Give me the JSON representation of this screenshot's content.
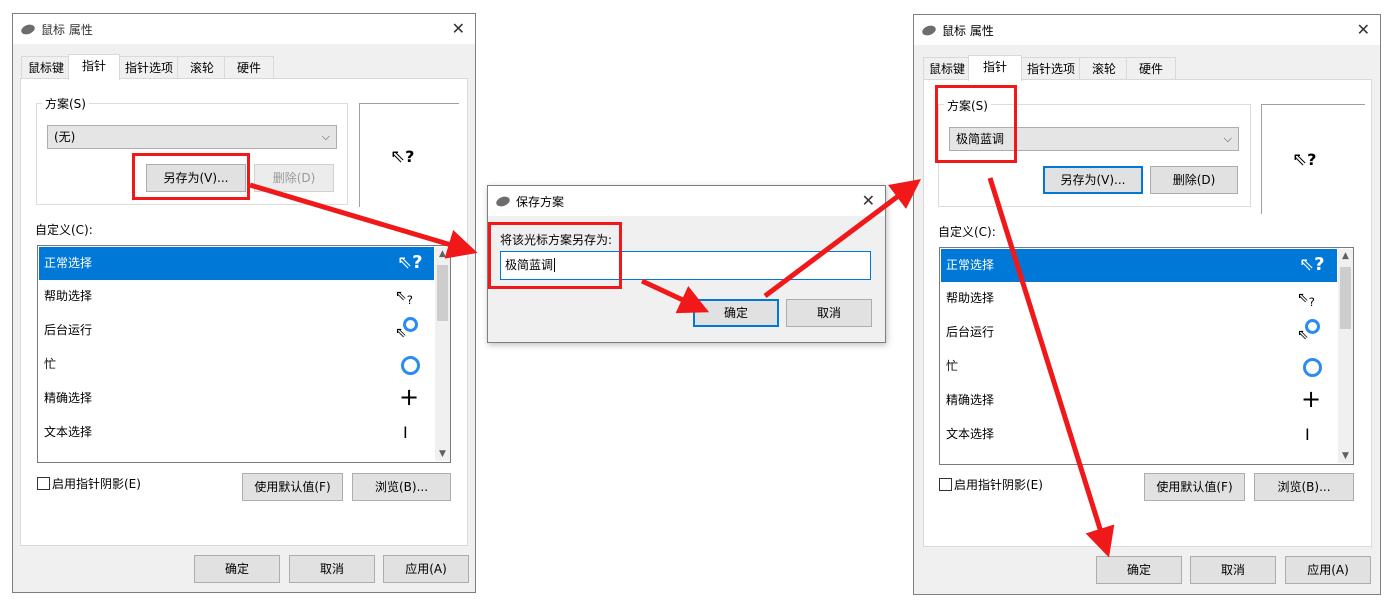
{
  "left_window": {
    "title": "鼠标 属性",
    "tabs": [
      "鼠标键",
      "指针",
      "指针选项",
      "滚轮",
      "硬件"
    ],
    "scheme_label": "方案(S)",
    "scheme_value": "(无)",
    "save_as_button": "另存为(V)...",
    "delete_button": "删除(D)",
    "customize_label": "自定义(C):",
    "list_items": [
      "正常选择",
      "帮助选择",
      "后台运行",
      "忙",
      "精确选择",
      "文本选择"
    ],
    "shadow_checkbox": "启用指针阴影(E)",
    "default_button": "使用默认值(F)",
    "browse_button": "浏览(B)...",
    "ok_button": "确定",
    "cancel_button": "取消",
    "apply_button": "应用(A)"
  },
  "dialog": {
    "title": "保存方案",
    "prompt": "将该光标方案另存为:",
    "input_value": "极简蓝调",
    "ok_button": "确定",
    "cancel_button": "取消"
  },
  "right_window": {
    "title": "鼠标 属性",
    "tabs": [
      "鼠标键",
      "指针",
      "指针选项",
      "滚轮",
      "硬件"
    ],
    "scheme_label": "方案(S)",
    "scheme_value": "极简蓝调",
    "save_as_button": "另存为(V)...",
    "delete_button": "删除(D)",
    "customize_label": "自定义(C):",
    "list_items": [
      "正常选择",
      "帮助选择",
      "后台运行",
      "忙",
      "精确选择",
      "文本选择"
    ],
    "shadow_checkbox": "启用指针阴影(E)",
    "default_button": "使用默认值(F)",
    "browse_button": "浏览(B)...",
    "ok_button": "确定",
    "cancel_button": "取消",
    "apply_button": "应用(A)"
  },
  "icons": {
    "preview": "pointer-help-icon",
    "accent_color": "#0078d7",
    "annotation_color": "#f01818"
  }
}
